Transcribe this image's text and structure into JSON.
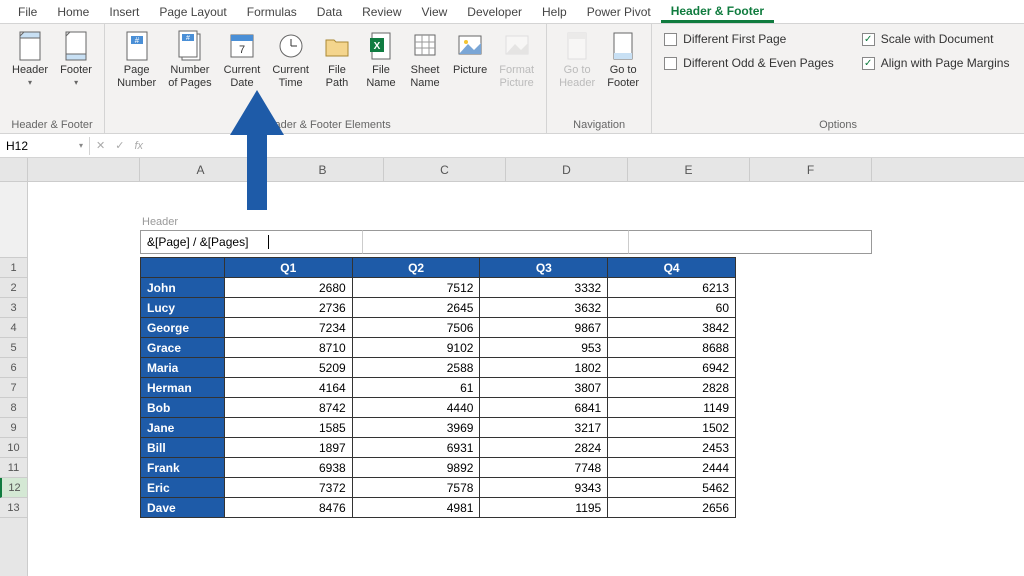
{
  "tabs": [
    "File",
    "Home",
    "Insert",
    "Page Layout",
    "Formulas",
    "Data",
    "Review",
    "View",
    "Developer",
    "Help",
    "Power Pivot",
    "Header & Footer"
  ],
  "active_tab": "Header & Footer",
  "ribbon": {
    "hf": {
      "header": "Header",
      "footer": "Footer",
      "label": "Header & Footer"
    },
    "elements": {
      "page_number": "Page\nNumber",
      "number_of_pages": "Number\nof Pages",
      "current_date": "Current\nDate",
      "current_time": "Current\nTime",
      "file_path": "File\nPath",
      "file_name": "File\nName",
      "sheet_name": "Sheet\nName",
      "picture": "Picture",
      "format_picture": "Format\nPicture",
      "label": "Header & Footer Elements"
    },
    "nav": {
      "go_to_header": "Go to\nHeader",
      "go_to_footer": "Go to\nFooter",
      "label": "Navigation"
    },
    "options": {
      "diff_first": "Different First Page",
      "diff_odd_even": "Different Odd & Even Pages",
      "scale": "Scale with Document",
      "align": "Align with Page Margins",
      "label": "Options"
    }
  },
  "name_box": "H12",
  "header_label": "Header",
  "header_code": "&[Page] / &[Pages]",
  "columns": [
    "A",
    "B",
    "C",
    "D",
    "E",
    "F"
  ],
  "rows": [
    "1",
    "2",
    "3",
    "4",
    "5",
    "6",
    "7",
    "8",
    "9",
    "10",
    "11",
    "12",
    "13"
  ],
  "selected_row": "12",
  "chart_data": {
    "type": "table",
    "headers": [
      "",
      "Q1",
      "Q2",
      "Q3",
      "Q4"
    ],
    "rows": [
      [
        "John",
        2680,
        7512,
        3332,
        6213
      ],
      [
        "Lucy",
        2736,
        2645,
        3632,
        60
      ],
      [
        "George",
        7234,
        7506,
        9867,
        3842
      ],
      [
        "Grace",
        8710,
        9102,
        953,
        8688
      ],
      [
        "Maria",
        5209,
        2588,
        1802,
        6942
      ],
      [
        "Herman",
        4164,
        61,
        3807,
        2828
      ],
      [
        "Bob",
        8742,
        4440,
        6841,
        1149
      ],
      [
        "Jane",
        1585,
        3969,
        3217,
        1502
      ],
      [
        "Bill",
        1897,
        6931,
        2824,
        2453
      ],
      [
        "Frank",
        6938,
        9892,
        7748,
        2444
      ],
      [
        "Eric",
        7372,
        7578,
        9343,
        5462
      ],
      [
        "Dave",
        8476,
        4981,
        1195,
        2656
      ]
    ]
  }
}
